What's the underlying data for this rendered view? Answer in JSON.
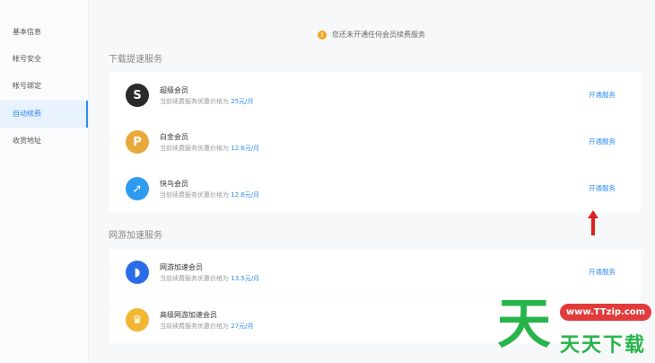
{
  "sidebar": {
    "items": [
      {
        "label": "基本信息",
        "active": false
      },
      {
        "label": "帐号安全",
        "active": false
      },
      {
        "label": "帐号绑定",
        "active": false
      },
      {
        "label": "自动续费",
        "active": true
      },
      {
        "label": "收货地址",
        "active": false
      }
    ]
  },
  "notice": {
    "text": "您还未开通任何会员续费服务"
  },
  "sections": {
    "download": {
      "title": "下载提速服务"
    },
    "game": {
      "title": "网游加速服务"
    }
  },
  "cards": [
    {
      "name": "超级会员",
      "desc_prefix": "当前续费服务优惠价格为",
      "price": "25元/月",
      "action": "开通服务",
      "icon": "super-vip-icon",
      "icon_glyph": "S",
      "color": "#2a2a2a"
    },
    {
      "name": "白金会员",
      "desc_prefix": "当前续费服务优惠价格为",
      "price": "12.6元/月",
      "action": "开通服务",
      "icon": "platinum-vip-icon",
      "icon_glyph": "P",
      "color": "#e9a93a"
    },
    {
      "name": "快鸟会员",
      "desc_prefix": "当前续费服务优惠价格为",
      "price": "12.6元/月",
      "action": "开通服务",
      "icon": "kuainiao-bird-icon",
      "icon_glyph": "➚",
      "color": "#2f9bf0"
    },
    {
      "name": "网游加速会员",
      "desc_prefix": "当前续费服务优惠价格为",
      "price": "13.5元/月",
      "action": "开通服务",
      "icon": "game-accelerator-icon",
      "icon_glyph": "◗",
      "color": "#2b6de8"
    },
    {
      "name": "高级网游加速会员",
      "desc_prefix": "当前续费服务优惠价格为",
      "price": "27元/月",
      "action": "",
      "icon": "crown-icon",
      "icon_glyph": "♛",
      "color": "#f2b632"
    }
  ],
  "watermark": {
    "big": "天",
    "url": "www.TTzip.com",
    "text": "天天下载"
  },
  "colors": {
    "accent": "#2d8cf0",
    "annotation_arrow": "#e02020",
    "watermark_green": "#27b44a"
  }
}
